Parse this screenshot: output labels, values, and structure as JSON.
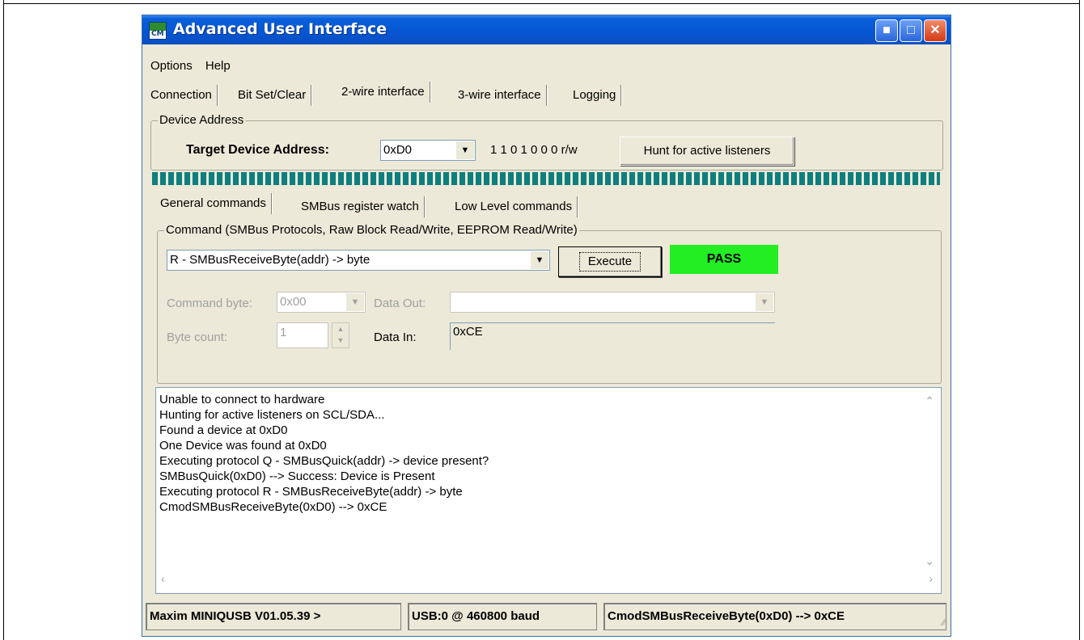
{
  "window": {
    "title": "Advanced User Interface",
    "logo_text": "CM",
    "controls": [
      "minimize",
      "maximize",
      "close"
    ]
  },
  "menu": {
    "items": [
      "Options",
      "Help"
    ]
  },
  "main_tabs": [
    {
      "label": "Connection"
    },
    {
      "label": "Bit Set/Clear"
    },
    {
      "label": "2-wire interface",
      "active": true
    },
    {
      "label": "3-wire interface"
    },
    {
      "label": "Logging"
    }
  ],
  "device_address": {
    "group_label": "Device Address",
    "target_label": "Target Device Address:",
    "address_value": "0xD0",
    "bits_text": "1 1 0 1 0 0 0 r/w",
    "hunt_button": "Hunt for active listeners"
  },
  "sub_tabs": [
    {
      "label": "General commands",
      "active": true
    },
    {
      "label": "SMBus register watch"
    },
    {
      "label": "Low Level commands"
    }
  ],
  "command": {
    "group_label": "Command (SMBus Protocols, Raw Block Read/Write, EEPROM Read/Write)",
    "protocol_value": "R - SMBusReceiveByte(addr) -> byte",
    "execute_button": "Execute",
    "result_text": "PASS",
    "result_color": "#22ee22",
    "command_byte_label": "Command byte:",
    "command_byte_value": "0x00",
    "data_out_label": "Data Out:",
    "data_out_value": "",
    "byte_count_label": "Byte count:",
    "byte_count_value": "1",
    "data_in_label": "Data In:",
    "data_in_value": "0xCE"
  },
  "log": {
    "lines": [
      "Unable to connect to hardware",
      "Hunting for active listeners on SCL/SDA...",
      "Found a device at 0xD0",
      "One Device was found at 0xD0",
      "Executing protocol Q - SMBusQuick(addr) -> device present?",
      "SMBusQuick(0xD0) --> Success: Device is Present",
      "Executing protocol R - SMBusReceiveByte(addr) -> byte",
      "CmodSMBusReceiveByte(0xD0) --> 0xCE"
    ]
  },
  "status_bar": {
    "device": "Maxim MINIQUSB V01.05.39 >",
    "port": "USB:0 @ 460800 baud",
    "last_result": "CmodSMBusReceiveByte(0xD0) --> 0xCE"
  }
}
